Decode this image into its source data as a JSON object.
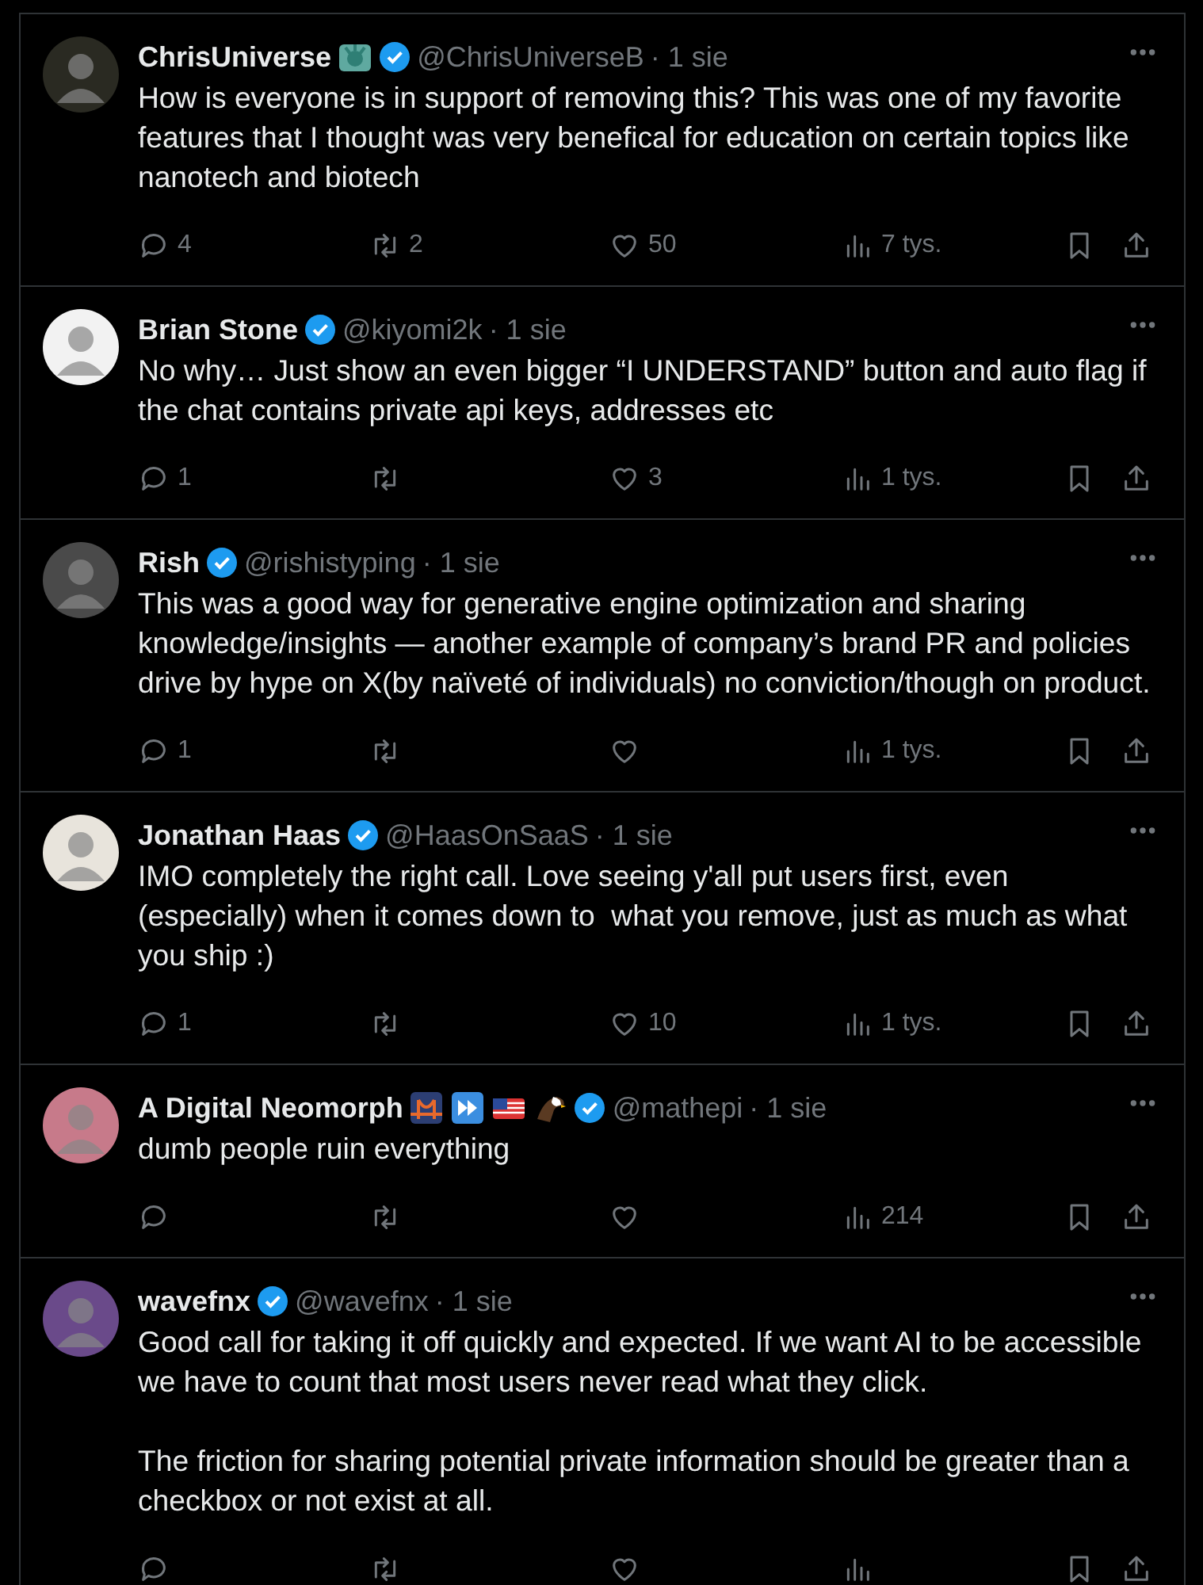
{
  "tweets": [
    {
      "name": "ChrisUniverse",
      "badges": [
        {
          "kind": "statue"
        }
      ],
      "verified": true,
      "handle": "@ChrisUniverseB",
      "date": "· 1 sie",
      "color": "#2a2a22",
      "text": [
        "How is everyone is in support of removing this? This was one of my favorite features that I thought was very benefical for education on certain topics like nanotech and biotech"
      ],
      "replies": "4",
      "reposts": "2",
      "likes": "50",
      "views": "7 tys."
    },
    {
      "name": "Brian Stone",
      "verified": true,
      "handle": "@kiyomi2k",
      "date": "· 1 sie",
      "color": "#f2f2f2",
      "text": [
        "No why… Just show an even bigger “I UNDERSTAND” button and auto flag if the chat contains private api keys, addresses etc"
      ],
      "replies": "1",
      "likes": "3",
      "views": "1 tys."
    },
    {
      "name": "Rish",
      "verified": true,
      "handle": "@rishistyping",
      "date": "· 1 sie",
      "color": "#4a4a4a",
      "text": [
        "This was a good way for generative engine optimization and sharing knowledge/insights — another example of company’s brand PR and policies drive by hype on X(by naïveté of individuals) no conviction/though on product."
      ],
      "replies": "1",
      "views": "1 tys."
    },
    {
      "name": "Jonathan Haas",
      "verified": true,
      "handle": "@HaasOnSaaS",
      "date": "· 1 sie",
      "color": "#e8e4dc",
      "text": [
        "IMO completely the right call. Love seeing y'all put users first, even (especially) when it comes down to  what you remove, just as much as what you ship :)"
      ],
      "replies": "1",
      "likes": "10",
      "views": "1 tys."
    },
    {
      "name": "A Digital Neomorph",
      "badges": [
        {
          "kind": "bridge"
        },
        {
          "kind": "fast-forward"
        },
        {
          "kind": "flag"
        },
        {
          "kind": "eagle"
        }
      ],
      "verified": true,
      "handle": "@mathepi",
      "date": "· 1 sie",
      "color": "#c77a8a",
      "text": [
        "dumb people ruin everything"
      ],
      "views": "214"
    },
    {
      "name": "wavefnx",
      "verified": true,
      "handle": "@wavefnx",
      "date": "· 1 sie",
      "color": "#6a4a8a",
      "text": [
        "Good call for taking it off quickly and expected. If we want AI to be accessible we have to count that most users never read what they click.",
        "The friction for sharing potential private information should be greater than a checkbox or not exist at all."
      ]
    }
  ]
}
